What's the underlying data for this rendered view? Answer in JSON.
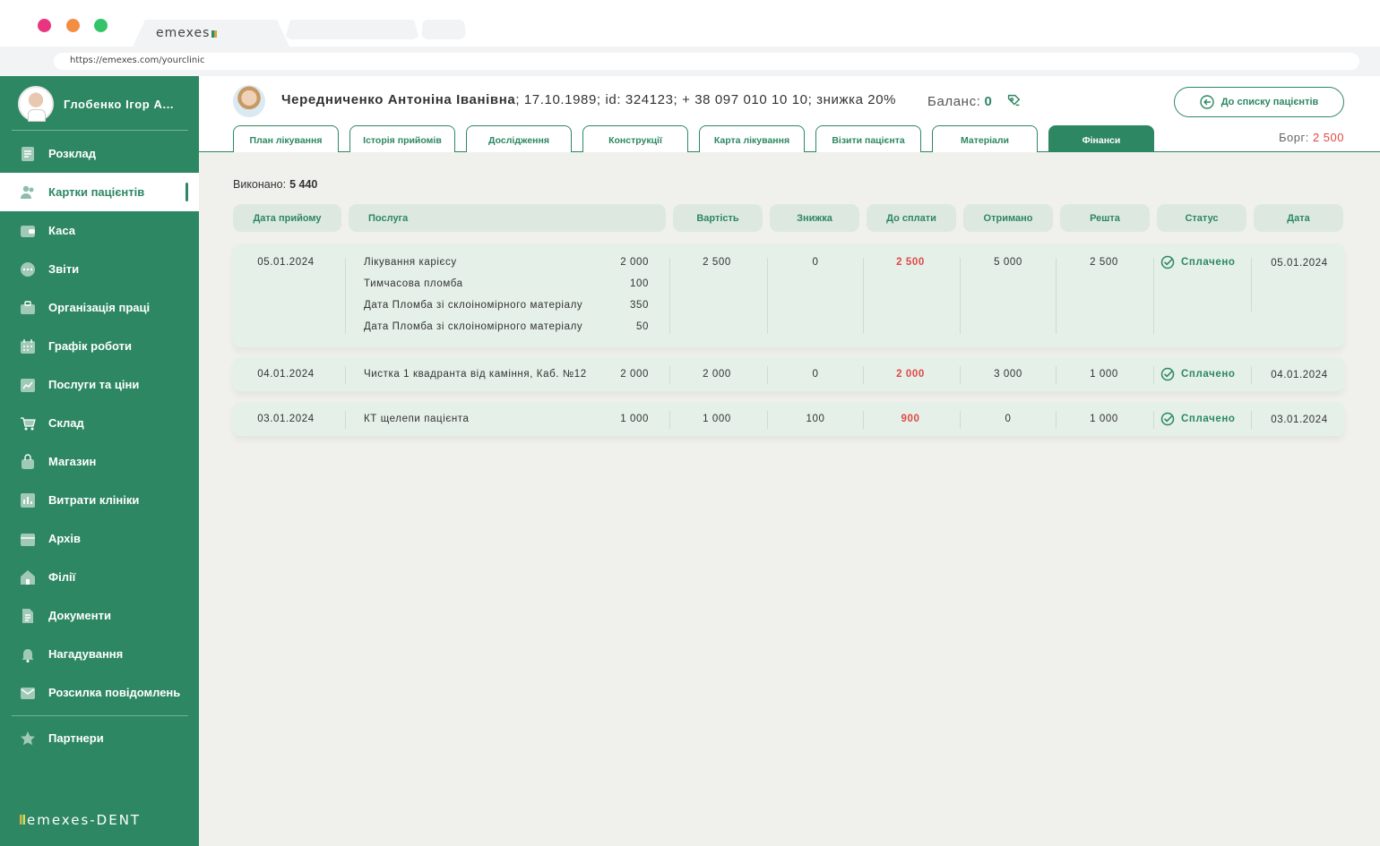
{
  "browser": {
    "tab_title": "emexes",
    "url": "https://emexes.com/yourclinic"
  },
  "sidebar": {
    "user_name": "Глобенко Ігор А...",
    "items": [
      {
        "label": "Розклад",
        "icon": "schedule-icon"
      },
      {
        "label": "Картки пацієнтів",
        "icon": "patients-icon",
        "active": true
      },
      {
        "label": "Каса",
        "icon": "wallet-icon"
      },
      {
        "label": "Звіти",
        "icon": "reports-icon"
      },
      {
        "label": "Організація праці",
        "icon": "briefcase-icon"
      },
      {
        "label": "Графік роботи",
        "icon": "calendar-icon"
      },
      {
        "label": "Послуги та ціни",
        "icon": "chart-icon"
      },
      {
        "label": "Склад",
        "icon": "cart-icon"
      },
      {
        "label": "Магазин",
        "icon": "bag-icon"
      },
      {
        "label": "Витрати клініки",
        "icon": "bar-chart-icon"
      },
      {
        "label": "Архів",
        "icon": "archive-icon"
      },
      {
        "label": "Філії",
        "icon": "home-icon"
      },
      {
        "label": "Документи",
        "icon": "document-icon"
      },
      {
        "label": "Нагадування",
        "icon": "bell-icon"
      },
      {
        "label": "Розсилка повідомлень",
        "icon": "mail-icon"
      },
      {
        "label": "Партнери",
        "icon": "star-icon"
      }
    ],
    "brand": "emexes-DENT"
  },
  "header": {
    "patient_name": "Чередниченко Антоніна Іванівна",
    "patient_details": "; 17.10.1989; id: 324123; + 38 097 010 10 10; знижка 20%",
    "balance_label": "Баланс:",
    "balance_value": "0",
    "back_button": "До списку пацієнтів",
    "debt_label": "Борг:",
    "debt_value": "2 500",
    "tabs": [
      "План лікування",
      "Історія прийомів",
      "Дослідження",
      "Конструкції",
      "Карта лікування",
      "Візити пацієнта",
      "Матеріали",
      "Фінанси"
    ],
    "active_tab": "Фінанси"
  },
  "finance": {
    "done_label": "Виконано:",
    "done_value": "5 440",
    "columns": [
      "Дата прийому",
      "Послуга",
      "Вартість",
      "Знижка",
      "До сплати",
      "Отримано",
      "Решта",
      "Статус",
      "Дата"
    ],
    "rows": [
      {
        "visit_date": "05.01.2024",
        "services": [
          {
            "name": "Лікування карієсу",
            "price": "2 000"
          },
          {
            "name": "Тимчасова пломба",
            "price": "100"
          },
          {
            "name": "Дата Пломба зі склоіномірного матеріалу",
            "price": "350"
          },
          {
            "name": "Дата Пломба зі склоіномірного матеріалу",
            "price": "50"
          }
        ],
        "cost": "2 500",
        "discount": "0",
        "to_pay": "2 500",
        "received": "5 000",
        "rest": "2 500",
        "status": "Сплачено",
        "date": "05.01.2024"
      },
      {
        "visit_date": "04.01.2024",
        "services": [
          {
            "name": "Чистка 1 квадранта від каміння, Каб. №12",
            "price": "2 000"
          }
        ],
        "cost": "2 000",
        "discount": "0",
        "to_pay": "2 000",
        "received": "3 000",
        "rest": "1 000",
        "status": "Сплачено",
        "date": "04.01.2024"
      },
      {
        "visit_date": "03.01.2024",
        "services": [
          {
            "name": "КТ щелепи пацієнта",
            "price": "1 000"
          }
        ],
        "cost": "1 000",
        "discount": "100",
        "to_pay": "900",
        "received": "0",
        "rest": "1 000",
        "status": "Сплачено",
        "date": "03.01.2024"
      }
    ]
  },
  "colors": {
    "primary": "#2d8763",
    "debt": "#e14848",
    "background": "#f0f1ec",
    "row_background": "#e4f0e8",
    "header_cell": "#dde8e1"
  }
}
